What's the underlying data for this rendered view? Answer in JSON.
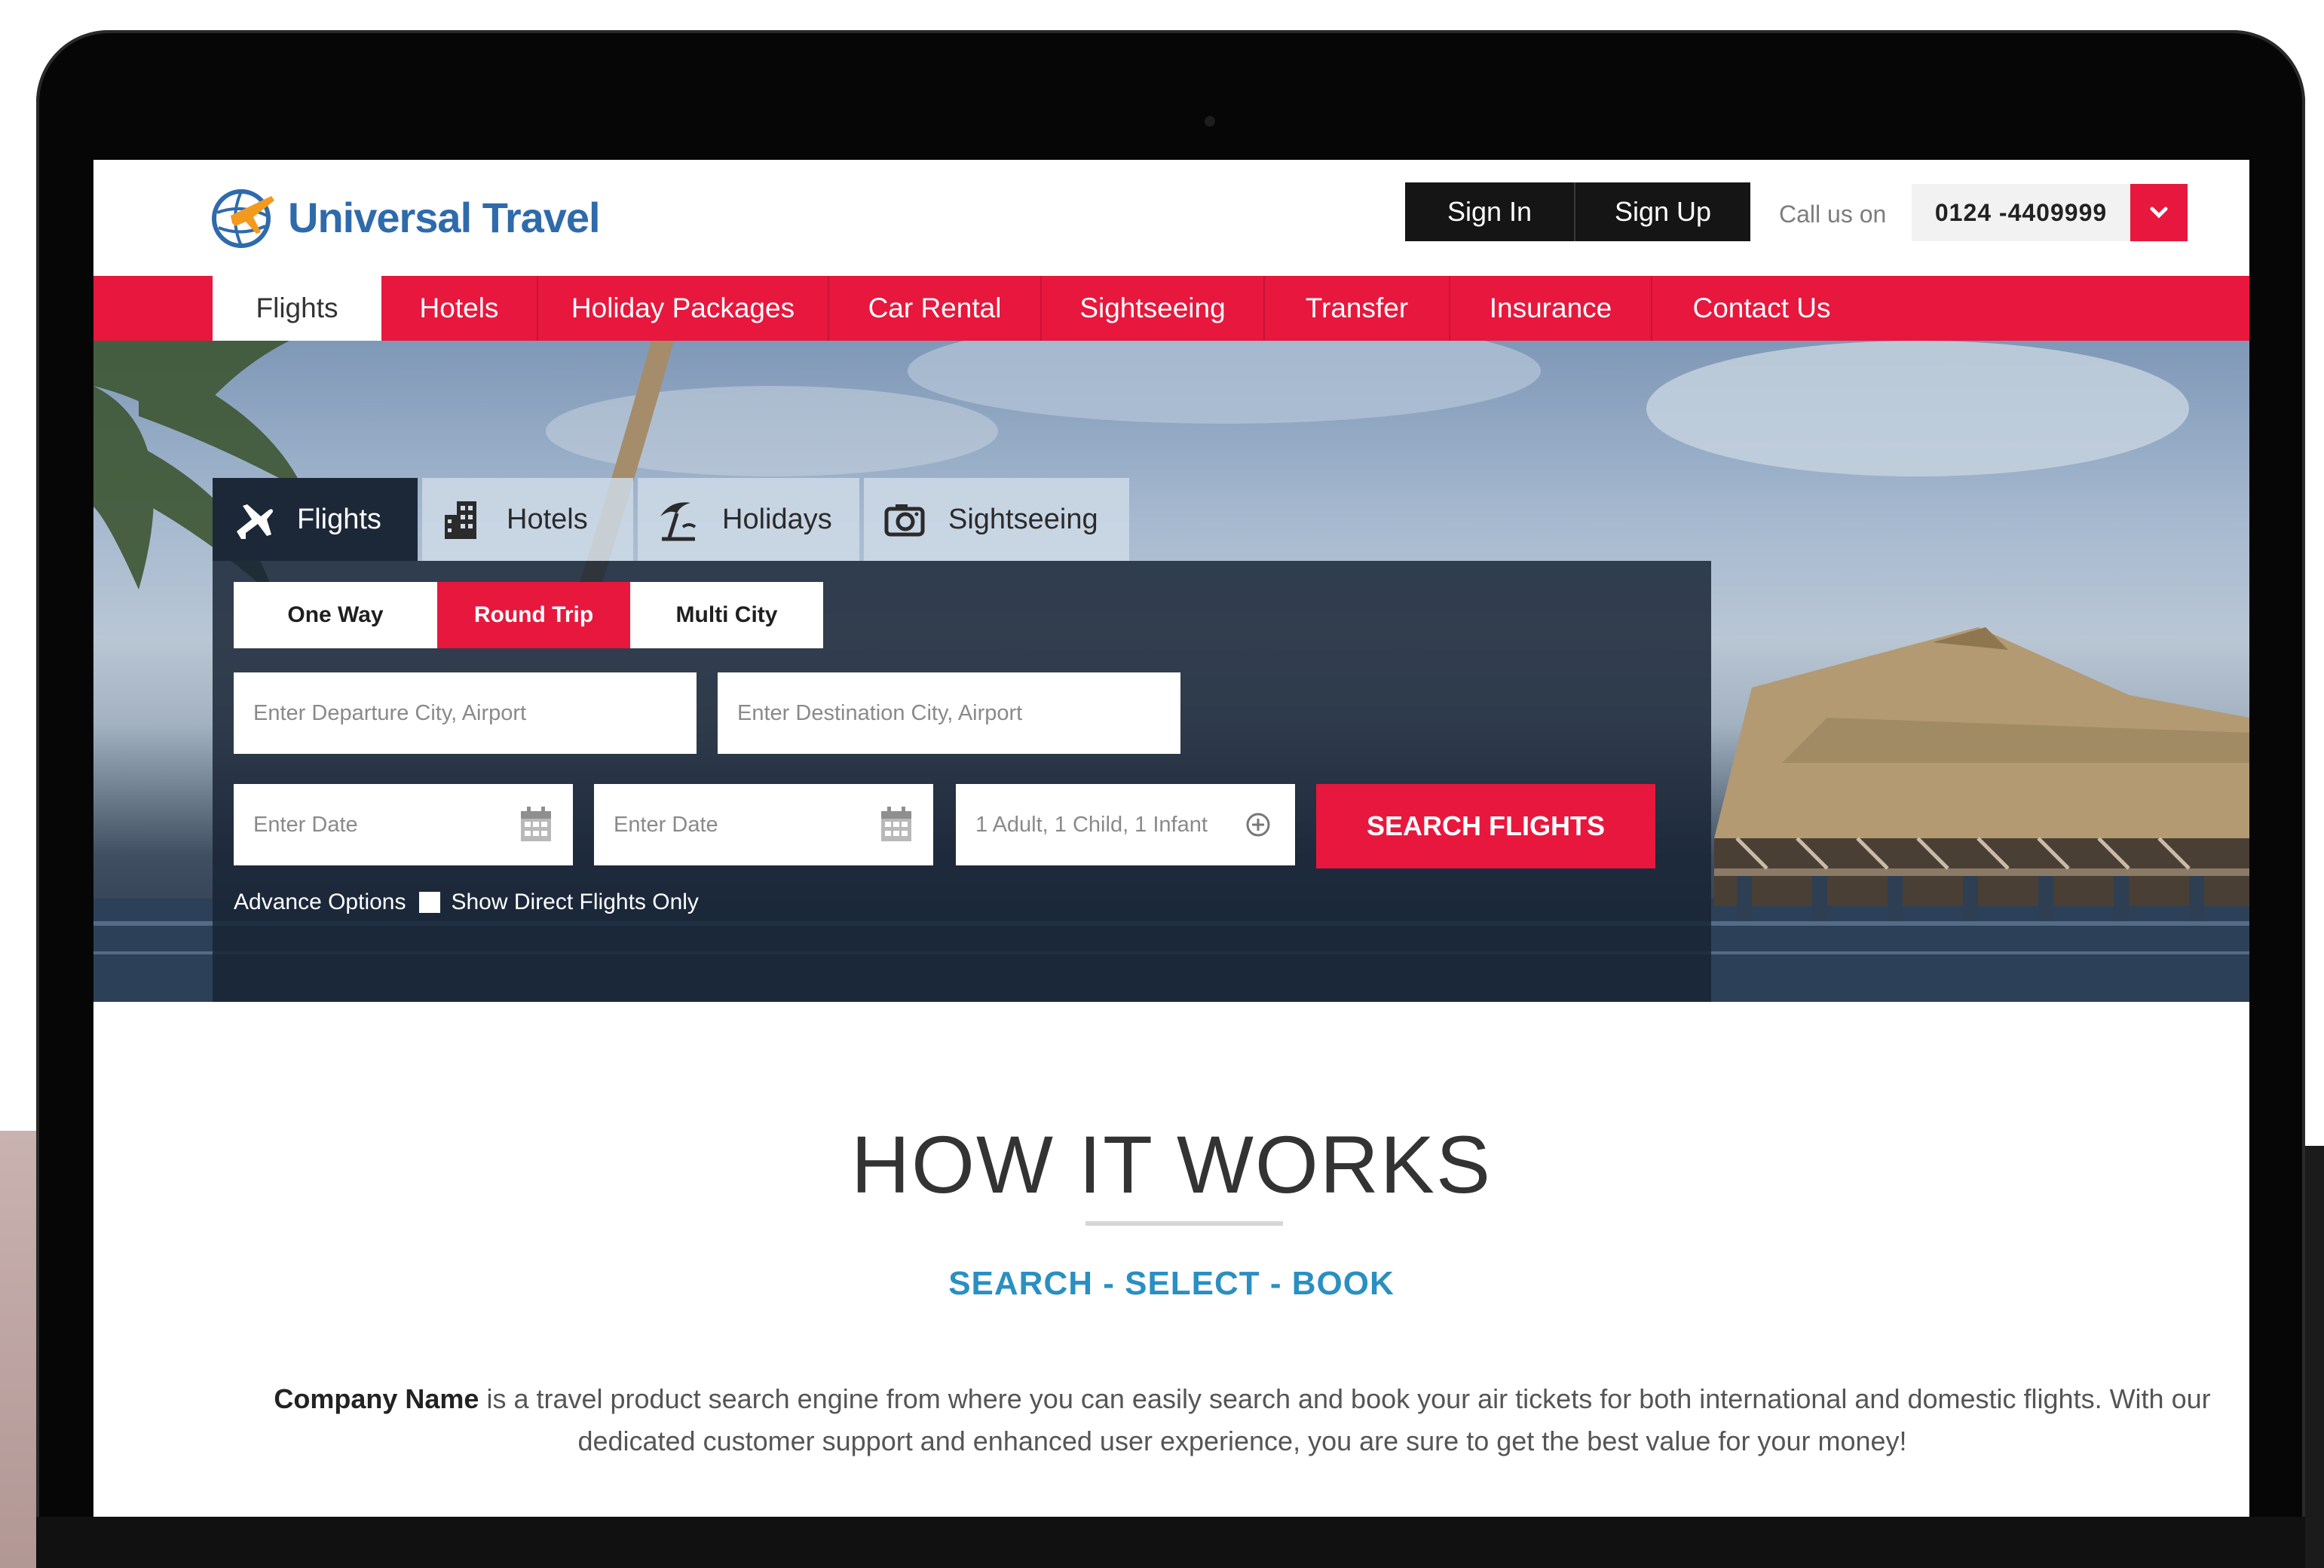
{
  "brand": {
    "name": "Universal Travel",
    "accent": "#e8173d",
    "logo_color": "#2f6aab"
  },
  "header": {
    "sign_in": "Sign In",
    "sign_up": "Sign Up",
    "call_label": "Call us on",
    "phone": "0124 -4409999",
    "dropdown_icon": "chevron-down-icon"
  },
  "nav": {
    "items": [
      {
        "label": "Flights",
        "active": true
      },
      {
        "label": "Hotels"
      },
      {
        "label": "Holiday Packages"
      },
      {
        "label": "Car Rental"
      },
      {
        "label": "Sightseeing"
      },
      {
        "label": "Transfer"
      },
      {
        "label": "Insurance"
      },
      {
        "label": "Contact Us"
      }
    ]
  },
  "search": {
    "tabs": [
      {
        "label": "Flights",
        "icon": "plane-icon",
        "active": true
      },
      {
        "label": "Hotels",
        "icon": "building-icon"
      },
      {
        "label": "Holidays",
        "icon": "beach-umbrella-icon"
      },
      {
        "label": "Sightseeing",
        "icon": "camera-icon"
      }
    ],
    "trip_types": [
      {
        "label": "One Way"
      },
      {
        "label": "Round Trip",
        "active": true
      },
      {
        "label": "Multi City"
      }
    ],
    "departure_placeholder": "Enter Departure City, Airport",
    "destination_placeholder": "Enter Destination City, Airport",
    "date1_placeholder": "Enter Date",
    "date2_placeholder": "Enter Date",
    "travellers": "1 Adult, 1 Child, 1 Infant",
    "search_button": "SEARCH FLIGHTS",
    "advance_options": "Advance Options",
    "direct_flights": "Show Direct Flights Only"
  },
  "how": {
    "title": "HOW IT WORKS",
    "subtitle": "SEARCH - SELECT - BOOK",
    "company": "Company Name",
    "body": " is a travel product search engine from where you can easily search and book your air tickets for both international and domestic flights. With our dedicated customer support and enhanced user experience, you are sure to get the best value for your money!"
  }
}
